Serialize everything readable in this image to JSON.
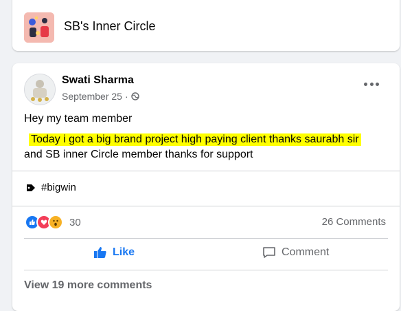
{
  "group": {
    "name": "SB's Inner Circle",
    "thumb_icon": "group-cover-image"
  },
  "post": {
    "author": "Swati Sharma",
    "date": "September 25",
    "privacy_icon": "globe-icon",
    "more_icon": "more-options-icon",
    "text": {
      "line1": "Hey my team member",
      "line2_highlighted": "Today i got a big brand project high paying client thanks saurabh sir",
      "line3": "and SB inner Circle member thanks for support"
    },
    "highlight_color": "#ffff00",
    "tag": "#bigwin",
    "reactions": {
      "icons": [
        "like-reaction-icon",
        "love-reaction-icon",
        "wow-reaction-icon"
      ],
      "count": "30"
    },
    "comments_count": "26 Comments",
    "actions": {
      "like_label": "Like",
      "comment_label": "Comment"
    },
    "view_more": "View 19 more comments"
  },
  "colors": {
    "accent": "#1877f2",
    "muted": "#65676b",
    "background": "#f0f2f5"
  }
}
